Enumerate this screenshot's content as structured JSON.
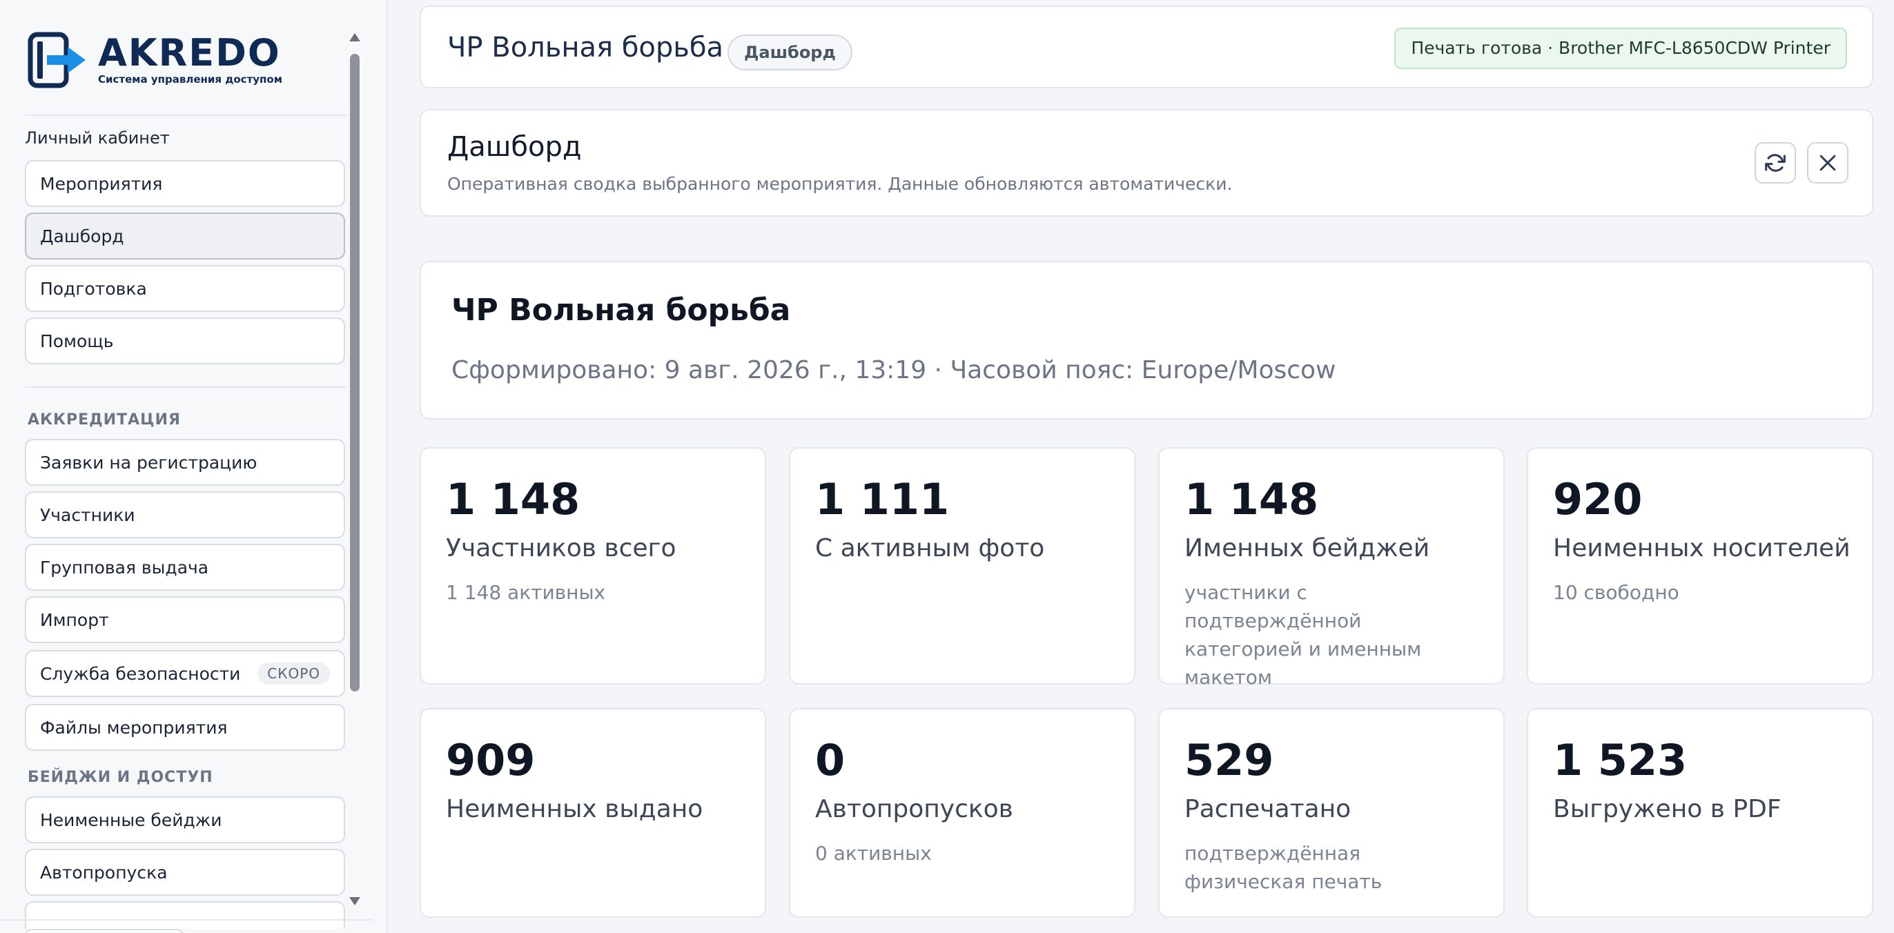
{
  "brand": {
    "name": "AKREDO",
    "tagline": "Система управления доступом",
    "colors": {
      "navy": "#0e2a55",
      "accent": "#1a8fe3"
    }
  },
  "sidebar": {
    "caption": "Личный кабинет",
    "top_items": [
      {
        "label": "Мероприятия",
        "active": false
      },
      {
        "label": "Дашборд",
        "active": true
      },
      {
        "label": "Подготовка",
        "active": false
      },
      {
        "label": "Помощь",
        "active": false
      }
    ],
    "sections": [
      {
        "title": "АККРЕДИТАЦИЯ",
        "items": [
          {
            "label": "Заявки на регистрацию"
          },
          {
            "label": "Участники"
          },
          {
            "label": "Групповая выдача"
          },
          {
            "label": "Импорт"
          },
          {
            "label": "Служба безопасности",
            "badge": "СКОРО"
          },
          {
            "label": "Файлы мероприятия"
          }
        ]
      },
      {
        "title": "БЕЙДЖИ И ДОСТУП",
        "items": [
          {
            "label": "Неименные бейджи"
          },
          {
            "label": "Автопропуска"
          }
        ]
      }
    ]
  },
  "header": {
    "title": "ЧР Вольная борьба",
    "badge": "Дашборд",
    "print_status": "Печать готова · Brother MFC-L8650CDW Printer"
  },
  "dashboard": {
    "title": "Дашборд",
    "subtitle": "Оперативная сводка выбранного мероприятия. Данные обновляются автоматически."
  },
  "event": {
    "title": "ЧР Вольная борьба",
    "meta": "Сформировано: 9 авг. 2026 г., 13:19 · Часовой пояс: Europe/Moscow"
  },
  "stats": [
    {
      "value": "1 148",
      "label": "Участников всего",
      "note": "1 148 активных"
    },
    {
      "value": "1 111",
      "label": "С активным фото",
      "note": ""
    },
    {
      "value": "1 148",
      "label": "Именных бейджей",
      "note": "участники с подтверждённой категорией и именным макетом"
    },
    {
      "value": "920",
      "label": "Неименных носителей",
      "note": "10 свободно"
    },
    {
      "value": "909",
      "label": "Неименных выдано",
      "note": ""
    },
    {
      "value": "0",
      "label": "Автопропусков",
      "note": "0 активных"
    },
    {
      "value": "529",
      "label": "Распечатано",
      "note": "подтверждённая физическая печать"
    },
    {
      "value": "1 523",
      "label": "Выгружено в PDF",
      "note": ""
    }
  ],
  "icons": {
    "refresh": "refresh-icon",
    "close": "close-icon",
    "scroll_up": "triangle-up-icon",
    "scroll_down": "triangle-down-icon"
  }
}
